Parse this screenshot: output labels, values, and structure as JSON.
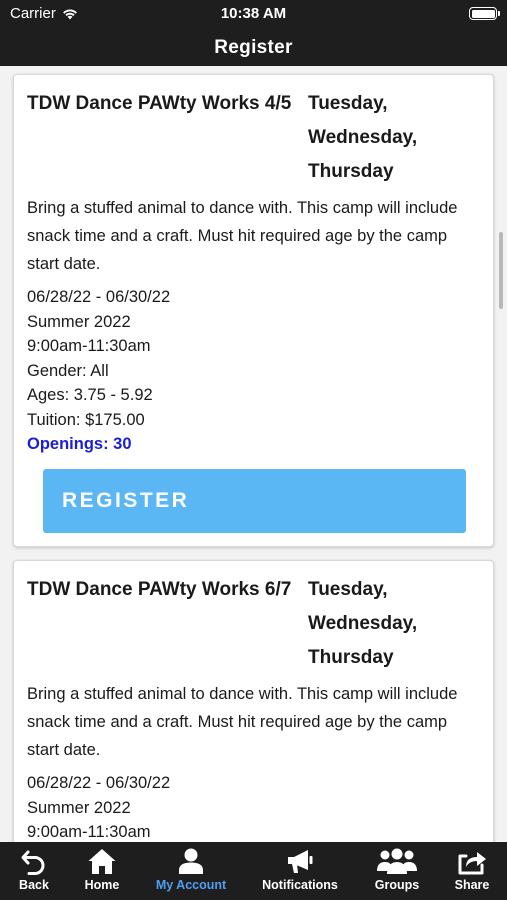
{
  "status_bar": {
    "carrier": "Carrier",
    "time": "10:38 AM"
  },
  "nav": {
    "title": "Register"
  },
  "cards": [
    {
      "name": "TDW Dance PAWty Works 4/5",
      "days": "Tuesday, Wednesday, Thursday",
      "description": "Bring a stuffed animal to dance with. This camp will include snack time and a craft. Must hit required age by the camp start date.",
      "dates": "06/28/22 - 06/30/22",
      "season": "Summer 2022",
      "time": "9:00am-11:30am",
      "gender": "Gender: All",
      "ages": "Ages: 3.75 - 5.92",
      "tuition": "Tuition: $175.00",
      "openings": "Openings: 30",
      "register_label": "REGISTER"
    },
    {
      "name": "TDW Dance PAWty Works 6/7",
      "days": "Tuesday, Wednesday, Thursday",
      "description": "Bring a stuffed animal to dance with. This camp will include snack time and a craft. Must hit required age by the camp start date.",
      "dates": "06/28/22 - 06/30/22",
      "season": "Summer 2022",
      "time": "9:00am-11:30am"
    }
  ],
  "tabs": [
    {
      "label": "Back",
      "icon": "back-arrow-icon"
    },
    {
      "label": "Home",
      "icon": "home-icon"
    },
    {
      "label": "My Account",
      "icon": "user-icon",
      "active": true
    },
    {
      "label": "Notifications",
      "icon": "megaphone-icon"
    },
    {
      "label": "Groups",
      "icon": "group-icon"
    },
    {
      "label": "Share",
      "icon": "share-icon"
    }
  ],
  "colors": {
    "bar_background": "#1e1e1e",
    "active_tab": "#4e9ff0",
    "register_button": "#5bb6f4",
    "openings_text": "#1a1ed6",
    "page_background": "#f2f2f2"
  }
}
